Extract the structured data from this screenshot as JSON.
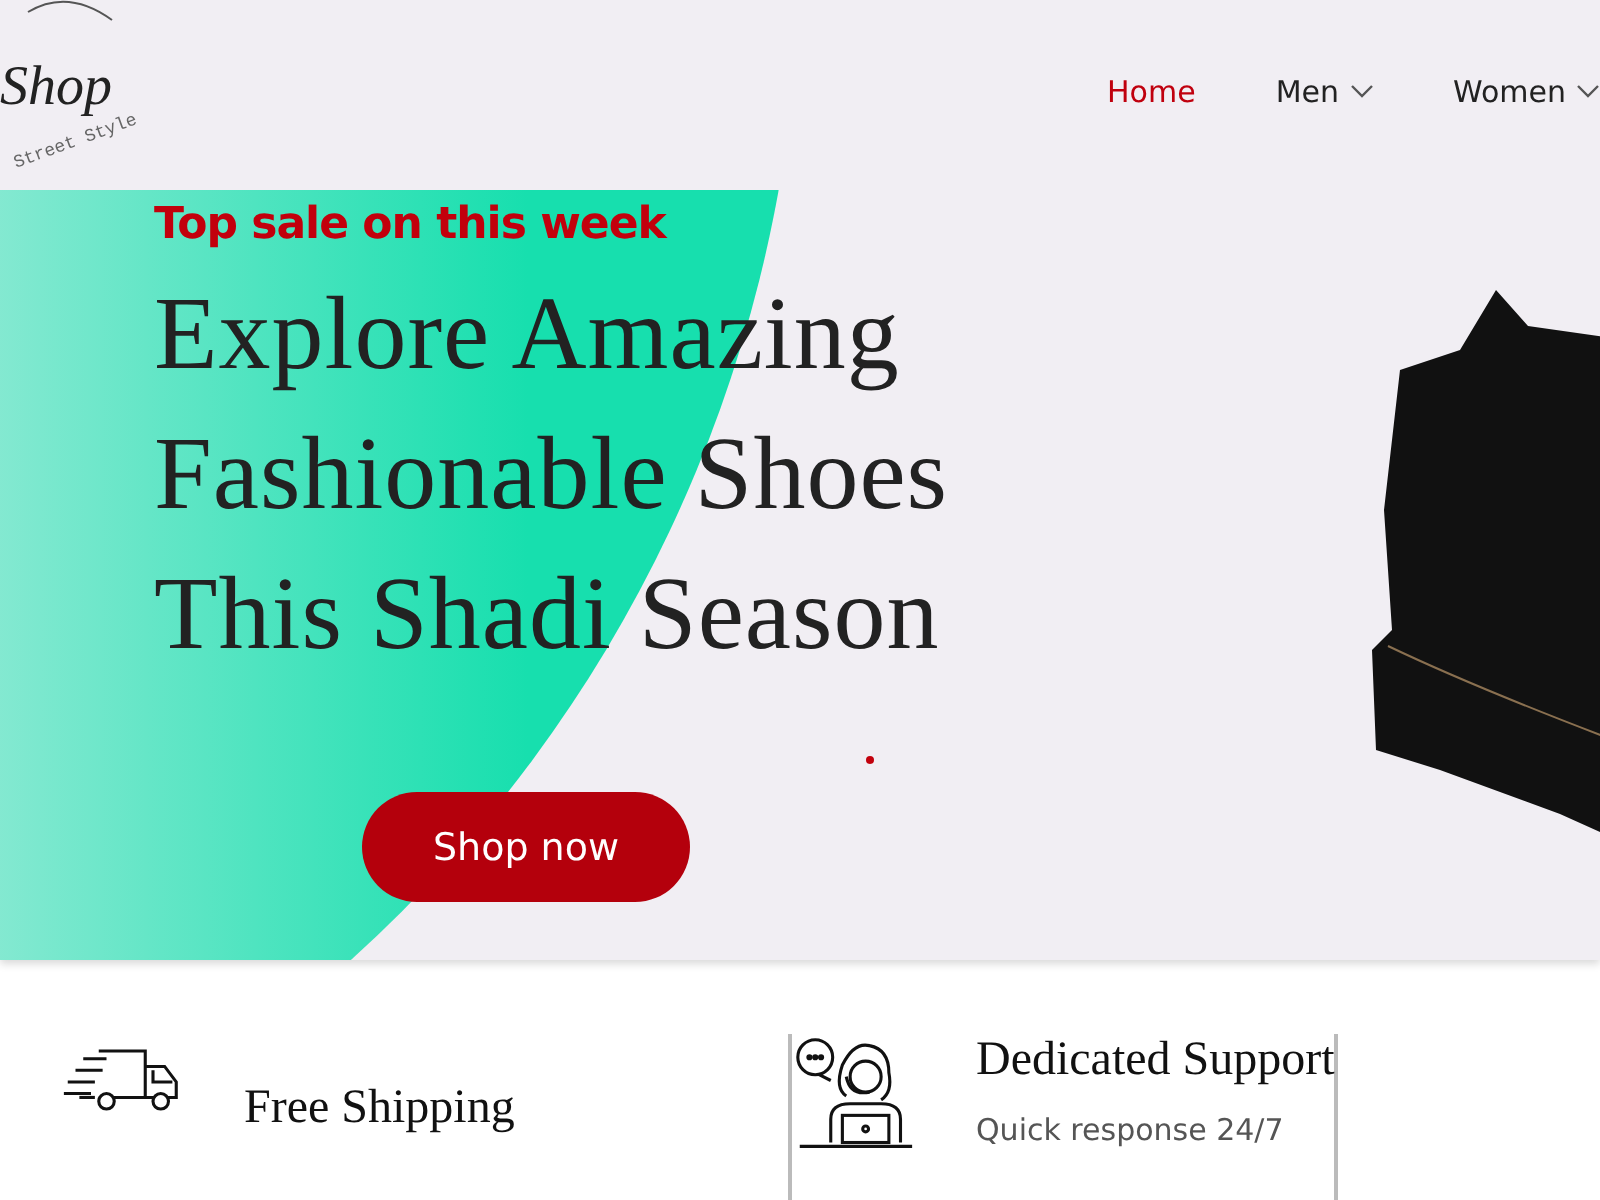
{
  "logo": {
    "script": "Shop",
    "tagline": "Street Style"
  },
  "nav": [
    {
      "label": "Home",
      "selected": true,
      "dropdown": false
    },
    {
      "label": "Men",
      "selected": false,
      "dropdown": true
    },
    {
      "label": "Women",
      "selected": false,
      "dropdown": true
    }
  ],
  "hero": {
    "eyebrow": "Top sale on this week",
    "headline": [
      "Explore Amazing",
      "Fashionable Shoes",
      "This Shadi Season"
    ],
    "button": "Shop now"
  },
  "features": [
    {
      "kind": "shipping",
      "title": "Free Shipping"
    },
    {
      "kind": "support",
      "title": "Dedicated Support",
      "subtitle": "Quick response 24/7"
    }
  ]
}
